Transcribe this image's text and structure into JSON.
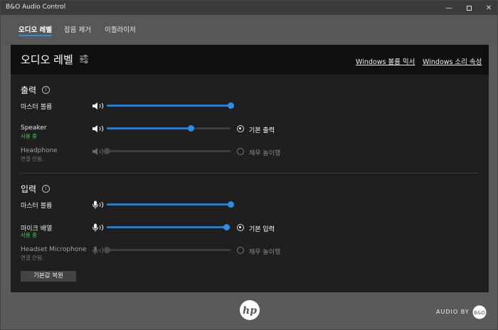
{
  "window": {
    "title": "B&O Audio Control"
  },
  "tabs": [
    {
      "label": "오디오 레벨",
      "active": true
    },
    {
      "label": "잡음 제거",
      "active": false
    },
    {
      "label": "이퀄라이저",
      "active": false
    }
  ],
  "header": {
    "title": "오디오 레벨",
    "link_mixer": "Windows 볼륨 믹서",
    "link_sound": "Windows 소리 속성"
  },
  "output": {
    "section_title": "출력",
    "master": {
      "label": "마스터 볼륨",
      "level": 1.0
    },
    "devices": [
      {
        "label": "Speaker",
        "status": "사용 중",
        "level": 0.68,
        "radio_label": "기본 출력",
        "selected": true,
        "enabled": true
      },
      {
        "label": "Headphone",
        "status": "연결 안됨.",
        "level": 0.0,
        "radio_label": "채우 놀이행",
        "selected": false,
        "enabled": false
      }
    ]
  },
  "input": {
    "section_title": "입력",
    "master": {
      "label": "마스터 볼륨",
      "level": 1.0
    },
    "devices": [
      {
        "label": "마이크 배열",
        "status": "사용 중",
        "level": 0.97,
        "radio_label": "기본 입력",
        "selected": true,
        "enabled": true
      },
      {
        "label": "Headset Microphone",
        "status": "연결 안됨.",
        "level": 0.0,
        "radio_label": "채우 놀이행",
        "selected": false,
        "enabled": false
      }
    ]
  },
  "reset_button": "기본값 복원",
  "footer": {
    "audio_by": "AUDIO BY",
    "bo_mark": "B&O"
  },
  "colors": {
    "accent": "#1a7fd9",
    "active_status": "#3fd34a"
  }
}
